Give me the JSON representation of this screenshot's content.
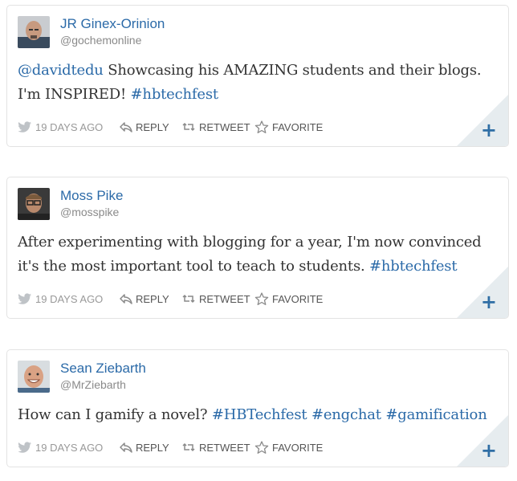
{
  "tweets": [
    {
      "name": "JR Ginex-Orinion",
      "handle": "@gochemonline",
      "text_parts": [
        {
          "t": "@davidtedu",
          "link": true
        },
        {
          "t": " Showcasing his AMAZING students and their blogs. I'm INSPIRED! ",
          "link": false
        },
        {
          "t": "#hbtechfest",
          "link": true
        }
      ],
      "time": "19 DAYS AGO",
      "reply": "REPLY",
      "retweet": "RETWEET",
      "favorite": "FAVORITE",
      "expand": "+",
      "avatar_icon": "bald-man-avatar"
    },
    {
      "name": "Moss Pike",
      "handle": "@mosspike",
      "text_parts": [
        {
          "t": "After experimenting with blogging for a year, I'm now convinced it's the most important tool to teach to students. ",
          "link": false
        },
        {
          "t": "#hbtechfest",
          "link": true
        }
      ],
      "time": "19 DAYS AGO",
      "reply": "REPLY",
      "retweet": "RETWEET",
      "favorite": "FAVORITE",
      "expand": "+",
      "avatar_icon": "glasses-man-avatar"
    },
    {
      "name": "Sean Ziebarth",
      "handle": "@MrZiebarth",
      "text_parts": [
        {
          "t": "How can I gamify a novel? ",
          "link": false
        },
        {
          "t": "#HBTechfest",
          "link": true
        },
        {
          "t": " ",
          "link": false
        },
        {
          "t": "#engchat",
          "link": true
        },
        {
          "t": " ",
          "link": false
        },
        {
          "t": "#gamification",
          "link": true
        }
      ],
      "time": "19 DAYS AGO",
      "reply": "REPLY",
      "retweet": "RETWEET",
      "favorite": "FAVORITE",
      "expand": "+",
      "avatar_icon": "smiling-man-avatar"
    }
  ],
  "colors": {
    "link": "#2b6aa8",
    "text": "#333333",
    "meta": "#8a8a8a",
    "corner": "#e6ecef"
  }
}
